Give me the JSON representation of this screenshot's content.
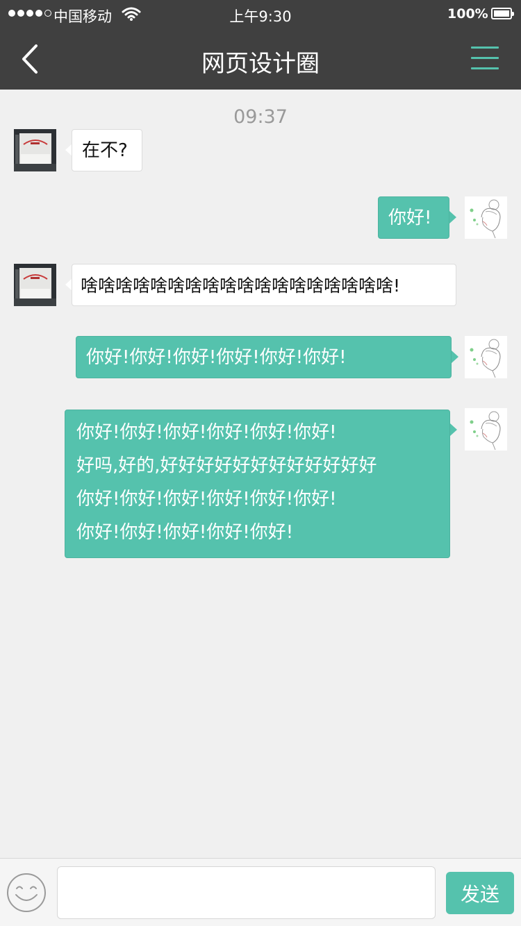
{
  "status_bar": {
    "carrier": "中国移动",
    "time": "上午9:30",
    "battery": "100%"
  },
  "header": {
    "title": "网页设计圈"
  },
  "chat": {
    "timestamp": "09:37",
    "messages": [
      {
        "side": "in",
        "lines": [
          "在不?"
        ]
      },
      {
        "side": "out",
        "lines": [
          "你好!"
        ]
      },
      {
        "side": "in",
        "lines": [
          "啥啥啥啥啥啥啥啥啥啥啥啥啥啥啥啥啥啥!"
        ]
      },
      {
        "side": "out",
        "lines": [
          "你好!你好!你好!你好!你好!你好!"
        ]
      },
      {
        "side": "out",
        "lines": [
          "你好!你好!你好!你好!你好!你好!",
          "好吗,好的,好好好好好好好好好好好好",
          "你好!你好!你好!你好!你好!你好!",
          "你好!你好!你好!你好!你好!"
        ]
      }
    ]
  },
  "input_bar": {
    "placeholder": "",
    "send_label": "发送"
  },
  "colors": {
    "header_bg": "#404040",
    "accent": "#55c2ad",
    "chat_bg": "#f0f0f0"
  }
}
